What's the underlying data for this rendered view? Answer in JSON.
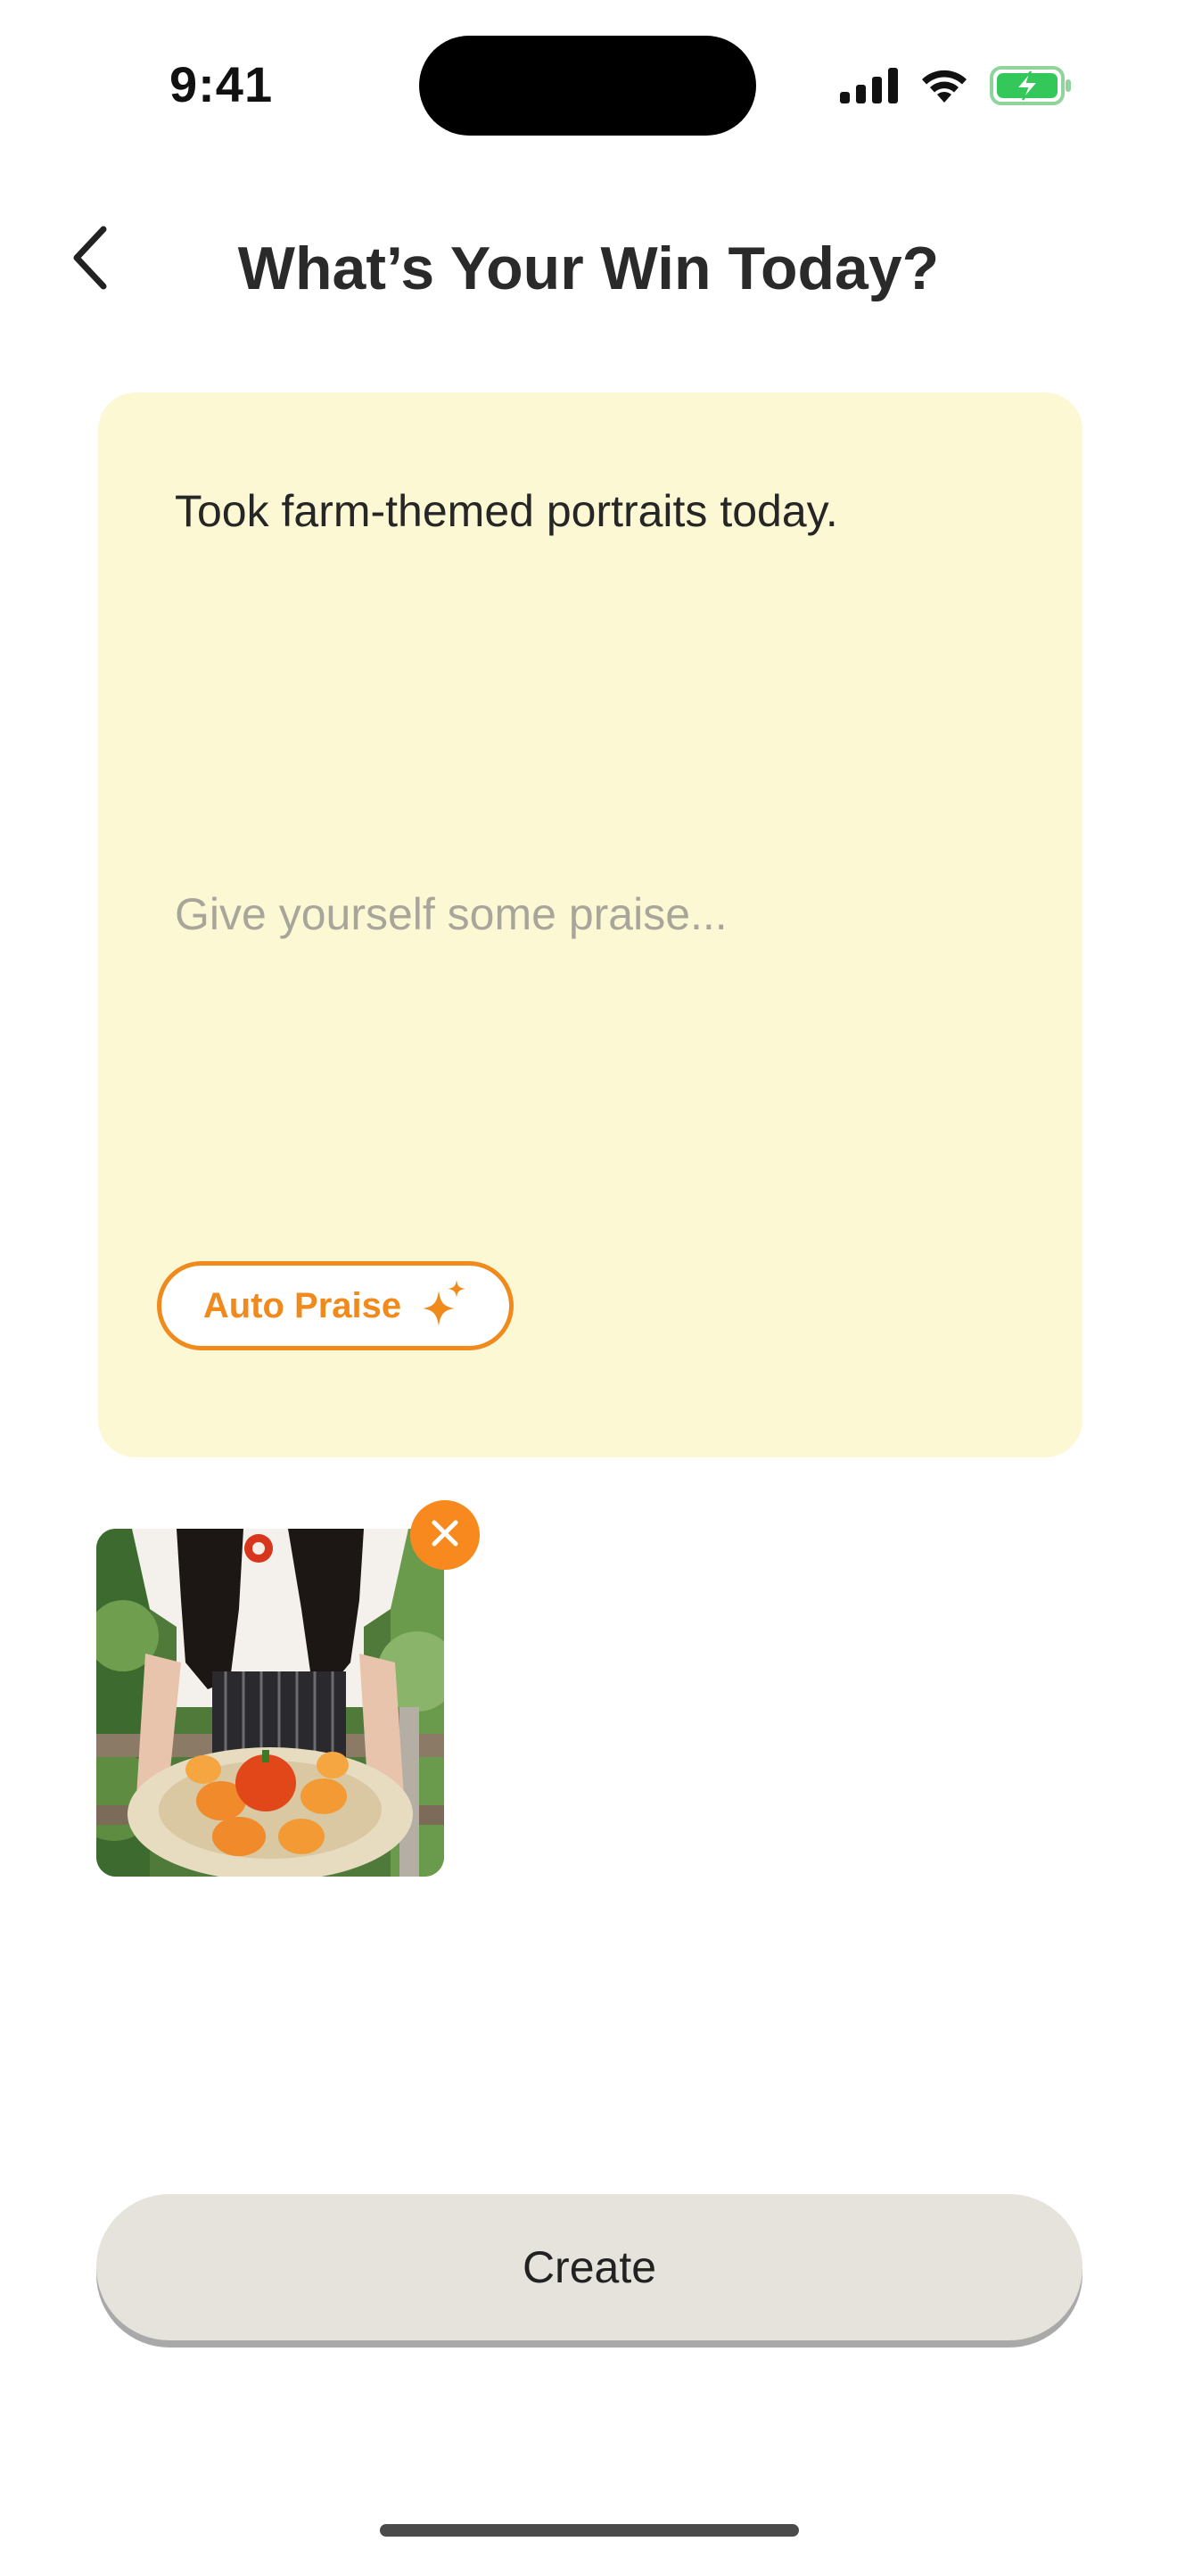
{
  "status_bar": {
    "time": "9:41",
    "icons": [
      "cellular-signal-icon",
      "wifi-icon",
      "battery-charging-icon"
    ],
    "battery_color": "#34c759"
  },
  "header": {
    "back_icon": "chevron-left-icon",
    "title": "What’s Your Win Today?"
  },
  "card": {
    "background": "#fcf8d4",
    "win_text": "Took farm-themed portraits today.",
    "praise_placeholder": "Give yourself some praise...",
    "auto_praise_label": "Auto Praise",
    "auto_praise_icon": "sparkles-icon",
    "accent_color": "#f08a1c"
  },
  "attachments": {
    "photos": [
      {
        "subject": "photo-thumbnail",
        "remove_icon": "close-icon"
      }
    ]
  },
  "actions": {
    "create_label": "Create"
  }
}
